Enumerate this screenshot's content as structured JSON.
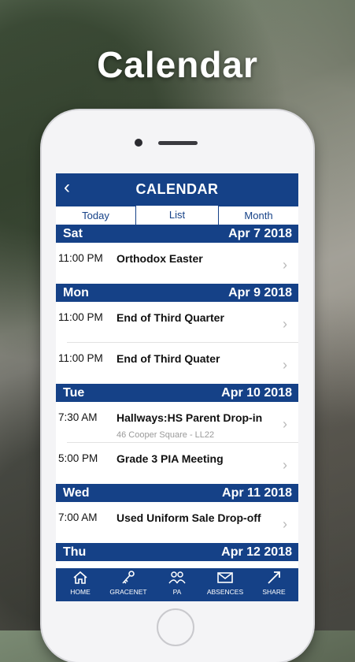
{
  "promo": {
    "headline": "Calendar"
  },
  "app": {
    "title": "CALENDAR",
    "back_icon": "‹",
    "tabs": [
      {
        "label": "Today",
        "active": false
      },
      {
        "label": "List",
        "active": true
      },
      {
        "label": "Month",
        "active": false
      }
    ]
  },
  "days": [
    {
      "day": "Sat",
      "date": "Apr 7 2018",
      "events": [
        {
          "time": "11:00 PM",
          "title": "Orthodox Easter",
          "location": ""
        }
      ]
    },
    {
      "day": "Mon",
      "date": "Apr 9 2018",
      "events": [
        {
          "time": "11:00 PM",
          "title": "End of Third Quarter",
          "location": ""
        },
        {
          "time": "11:00 PM",
          "title": "End of Third Quater",
          "location": ""
        }
      ]
    },
    {
      "day": "Tue",
      "date": "Apr 10 2018",
      "events": [
        {
          "time": "7:30 AM",
          "title": "Hallways:HS Parent Drop-in",
          "location": "46 Cooper Square - LL22"
        },
        {
          "time": "5:00 PM",
          "title": "Grade 3 PIA Meeting",
          "location": ""
        }
      ]
    },
    {
      "day": "Wed",
      "date": "Apr 11 2018",
      "events": [
        {
          "time": "7:00 AM",
          "title": "Used Uniform Sale Drop-off",
          "location": ""
        }
      ]
    },
    {
      "day": "Thu",
      "date": "Apr 12 2018",
      "events": []
    }
  ],
  "tabbar": [
    {
      "label": "HOME",
      "icon": "home-icon"
    },
    {
      "label": "GRACENET",
      "icon": "key-icon"
    },
    {
      "label": "PA",
      "icon": "people-icon"
    },
    {
      "label": "ABSENCES",
      "icon": "envelope-icon"
    },
    {
      "label": "SHARE",
      "icon": "share-icon"
    }
  ],
  "colors": {
    "brand": "#154187",
    "chevron": "#b9b9b9",
    "location_text": "#9a9a9a"
  }
}
